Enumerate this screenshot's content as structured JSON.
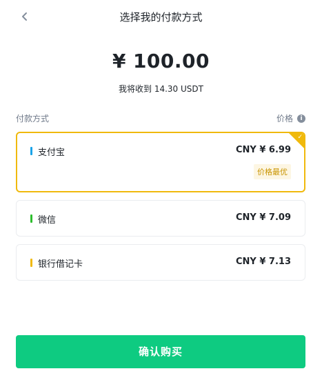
{
  "header": {
    "title": "选择我的付款方式",
    "back_icon": "chevron-left-icon"
  },
  "order": {
    "currency_symbol": "¥",
    "amount": "100.00",
    "receive_text": "我将收到 14.30 USDT"
  },
  "list_header": {
    "left_label": "付款方式",
    "right_label": "价格",
    "right_icon": "info-icon",
    "info_glyph": "i"
  },
  "methods": [
    {
      "name": "支付宝",
      "price": "CNY ¥ 6.99",
      "bar_color": "#1aa3e8",
      "selected": true,
      "badge": "价格最优",
      "selected_check_glyph": "✓"
    },
    {
      "name": "微信",
      "price": "CNY ¥ 7.09",
      "bar_color": "#2dbd2d",
      "selected": false
    },
    {
      "name": "银行借记卡",
      "price": "CNY ¥ 7.13",
      "bar_color": "#f0b90b",
      "selected": false
    }
  ],
  "confirm_button": {
    "label": "确认购买",
    "color": "#0ecb81"
  },
  "colors": {
    "accent": "#f0b90b",
    "text_primary": "#1e2329",
    "text_secondary": "#707a8a",
    "badge_text": "#c99400",
    "badge_bg": "#fdf6e3"
  }
}
